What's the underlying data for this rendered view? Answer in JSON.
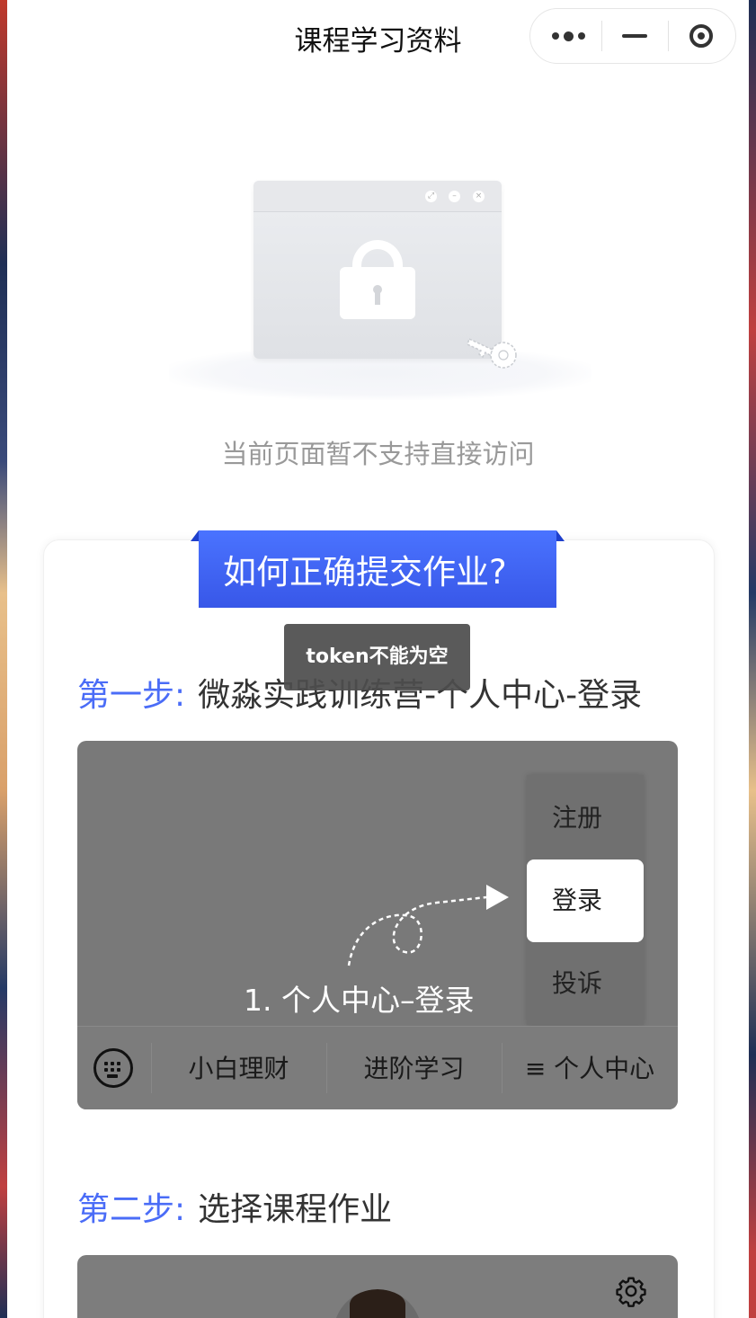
{
  "navbar": {
    "title": "课程学习资料",
    "more_icon": "more-dots-icon",
    "minimize_icon": "minimize-icon",
    "close_icon": "target-circle-icon"
  },
  "empty_state": {
    "illustration": "locked-window-illustration",
    "message": "当前页面暂不支持直接访问"
  },
  "guide": {
    "title": "如何正确提交作业?",
    "toast": "token不能为空",
    "steps": [
      {
        "label": "第一步:",
        "text": "微淼实践训练营-个人中心-登录"
      },
      {
        "label": "第二步:",
        "text": "选择课程作业"
      }
    ],
    "screenshot1": {
      "menu_items": [
        "注册",
        "登录",
        "投诉"
      ],
      "selected_menu": "登录",
      "caption": "1. 个人中心–登录",
      "tabs": [
        "小白理财",
        "进阶学习",
        "≡ 个人中心"
      ],
      "keyboard_icon": "keyboard-icon"
    },
    "screenshot2": {
      "settings_icon": "gear-icon"
    }
  },
  "colors": {
    "accent": "#4a6cf7",
    "ribbon": "#3f62f0",
    "toast_bg": "#4d4d4d"
  }
}
